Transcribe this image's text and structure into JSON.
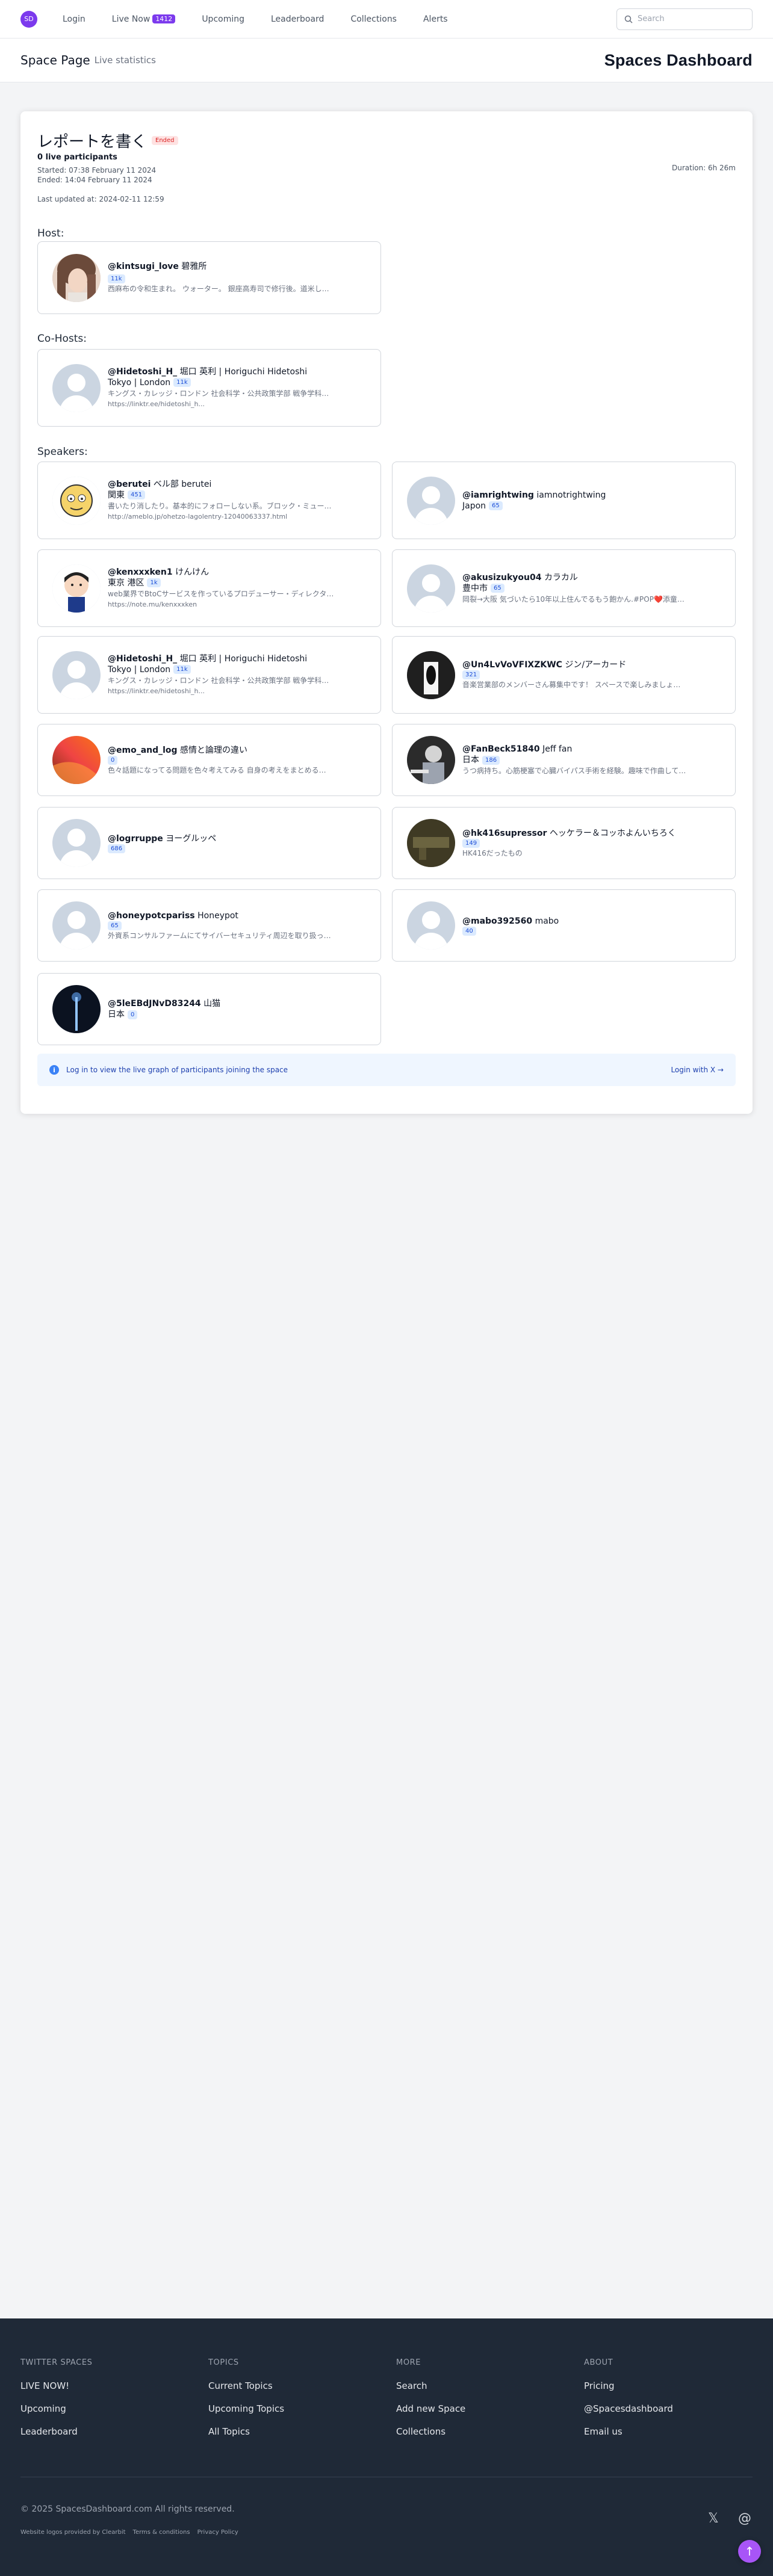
{
  "nav": {
    "logo_text": "SD",
    "links": [
      "Login",
      "Live Now",
      "Upcoming",
      "Leaderboard",
      "Collections",
      "Alerts"
    ],
    "live_count": "1412",
    "search_placeholder": "Search"
  },
  "header": {
    "title": "Space Page",
    "subtitle": "Live statistics",
    "brand": "Spaces Dashboard"
  },
  "space": {
    "title": "レポートを書く",
    "status": "Ended",
    "live_participants": "0 live participants",
    "started": "Started: 07:38 February 11 2024",
    "ended": "Ended: 14:04 February 11 2024",
    "last_updated": "Last updated at: 2024-02-11 12:59",
    "duration": "Duration: 6h 26m"
  },
  "sections": {
    "host": "Host:",
    "cohosts": "Co-Hosts:",
    "speakers": "Speakers:"
  },
  "host": {
    "handle": "@kintsugi_love",
    "name": "碧雅所",
    "followers": "11k",
    "bio": "西麻布の令和生まれ。 ウォーター。 銀座高寿司で修行後。道米し…"
  },
  "cohost": {
    "handle": "@Hidetoshi_H_",
    "name": "堀口 英利 | Horiguchi Hidetoshi",
    "location": "Tokyo | London",
    "followers": "11k",
    "bio": "キングス・カレッジ・ロンドン 社会科学・公共政策学部 戦争学科…",
    "link": "https://linktr.ee/hidetoshi_h..."
  },
  "speakers": [
    {
      "handle": "@berutei",
      "name": "ベル部 berutei",
      "location": "関東",
      "followers": "451",
      "bio": "書いたり消したり。基本的にフォローしない系。ブロック・ミュー…",
      "link": "http://ameblo.jp/ohetzo-lagolentry-12040063337.html",
      "avatar": "cartoon"
    },
    {
      "handle": "@iamrightwing",
      "name": "iamnotrightwing",
      "location": "Japon",
      "followers": "65",
      "bio": "",
      "link": "",
      "avatar": "default"
    },
    {
      "handle": "@kenxxxken1",
      "name": "けんけん",
      "location": "東京 港区",
      "followers": "1k",
      "bio": "web業界でBtoCサービスを作っているプロデューサー・ディレクタ…",
      "link": "https://note.mu/kenxxxken",
      "avatar": "boy"
    },
    {
      "handle": "@akusizukyou04",
      "name": "カラカル",
      "location": "豊中市",
      "followers": "65",
      "bio": "岡裂→大阪 気づいたら10年以上住んでるもう飽かん.#POP❤️添童…",
      "link": "",
      "avatar": "default"
    },
    {
      "handle": "@Hidetoshi_H_",
      "name": "堀口 英利 | Horiguchi Hidetoshi",
      "location": "Tokyo | London",
      "followers": "11k",
      "bio": "キングス・カレッジ・ロンドン 社会科学・公共政策学部 戦争学科…",
      "link": "https://linktr.ee/hidetoshi_h...",
      "avatar": "default"
    },
    {
      "handle": "@Un4LvVoVFIXZKWC",
      "name": "ジン/アーカード",
      "location": "",
      "followers": "321",
      "bio": "音楽営業部のメンバーさん募集中です！ スペースで楽しみましょ…",
      "link": "",
      "avatar": "dark"
    },
    {
      "handle": "@emo_and_log",
      "name": "感情と論理の違い",
      "location": "",
      "followers": "0",
      "bio": "色々話題になってる問題を色々考えてみる 自身の考えをまとめる…",
      "link": "",
      "avatar": "gradient"
    },
    {
      "handle": "@FanBeck51840",
      "name": "Jeff fan",
      "location": "日本",
      "followers": "186",
      "bio": "うつ病持ち。心筋梗塞で心臓バイパス手術を経験。趣味で作曲して…",
      "link": "",
      "avatar": "bw"
    },
    {
      "handle": "@logrruppe",
      "name": "ヨーグルッペ",
      "location": "",
      "followers": "686",
      "bio": "",
      "link": "",
      "avatar": "default"
    },
    {
      "handle": "@hk416supressor",
      "name": "ヘッケラー＆コッホよんいちろく",
      "location": "",
      "followers": "149",
      "bio": "HK416だったもの",
      "link": "",
      "avatar": "olive"
    },
    {
      "handle": "@honeypotcpariss",
      "name": "Honeypot",
      "location": "",
      "followers": "65",
      "bio": "外資系コンサルファームにてサイバーセキュリティ周辺を取り扱っ…",
      "link": "",
      "avatar": "default"
    },
    {
      "handle": "@mabo392560",
      "name": "mabo",
      "location": "",
      "followers": "40",
      "bio": "",
      "link": "",
      "avatar": "default"
    },
    {
      "handle": "@5leEBdJNvD83244",
      "name": "山猫",
      "location": "日本",
      "followers": "0",
      "bio": "",
      "link": "",
      "avatar": "night"
    }
  ],
  "info_bar": {
    "message": "Log in to view the live graph of participants joining the space",
    "action": "Login with X →"
  },
  "footer": {
    "columns": [
      {
        "title": "TWITTER SPACES",
        "links": [
          "LIVE NOW!",
          "Upcoming",
          "Leaderboard"
        ]
      },
      {
        "title": "TOPICS",
        "links": [
          "Current Topics",
          "Upcoming Topics",
          "All Topics"
        ]
      },
      {
        "title": "MORE",
        "links": [
          "Search",
          "Add new Space",
          "Collections"
        ]
      },
      {
        "title": "ABOUT",
        "links": [
          "Pricing",
          "@Spacesdashboard",
          "Email us"
        ]
      }
    ],
    "copyright": "© 2025 SpacesDashboard.com All rights reserved.",
    "small_links": [
      "Website logos provided by Clearbit",
      "Terms & conditions",
      "Privacy Policy"
    ]
  }
}
